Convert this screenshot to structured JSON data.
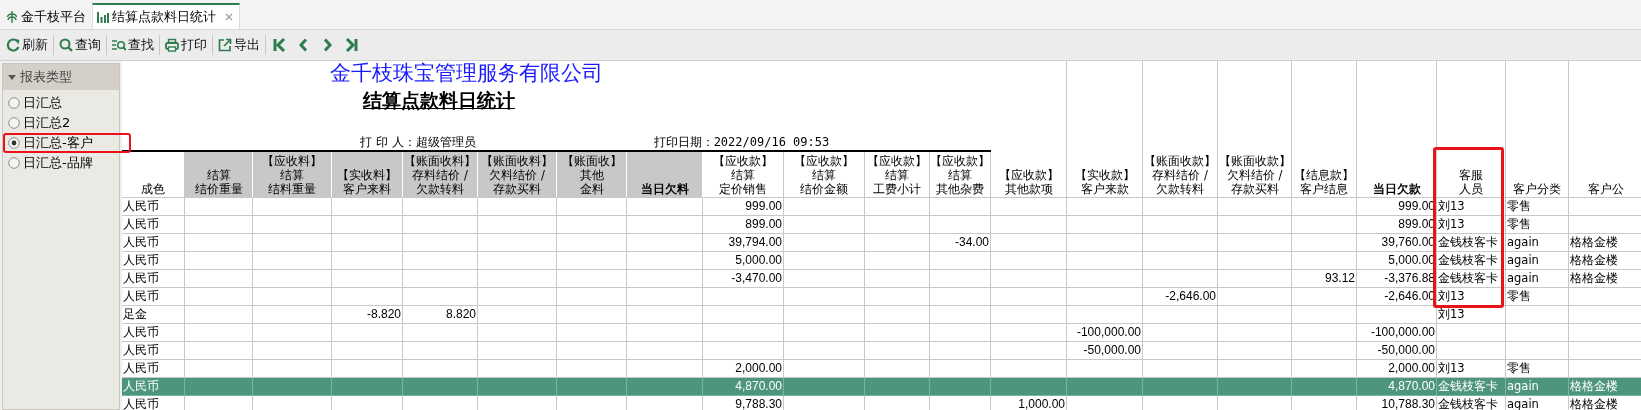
{
  "tabs": [
    {
      "label": "金千枝平台",
      "kind": "home",
      "selected": false,
      "closable": false
    },
    {
      "label": "结算点款料日统计",
      "kind": "report",
      "selected": true,
      "closable": true
    }
  ],
  "toolbar": {
    "buttons": [
      {
        "label": "刷新",
        "kind": "refresh"
      },
      {
        "label": "查询",
        "kind": "search"
      },
      {
        "label": "查找",
        "kind": "find"
      },
      {
        "label": "打印",
        "kind": "print"
      },
      {
        "label": "导出",
        "kind": "export"
      }
    ],
    "navigation": [
      {
        "kind": "first"
      },
      {
        "kind": "previous"
      },
      {
        "kind": "next"
      },
      {
        "kind": "last"
      }
    ]
  },
  "sidebar": {
    "title": "报表类型",
    "expanded": true,
    "items": [
      {
        "label": "日汇总",
        "selected": false,
        "highlighted": false
      },
      {
        "label": "日汇总2",
        "selected": false,
        "highlighted": false
      },
      {
        "label": "日汇总-客户",
        "selected": true,
        "highlighted": true
      },
      {
        "label": "日汇总-品牌",
        "selected": false,
        "highlighted": false
      }
    ]
  },
  "report": {
    "company": "金千枝珠宝管理服务有限公司",
    "title": "结算点款料日统计",
    "printed_by": "打 印 人：超级管理员",
    "print_date": "打印日期：2022/09/16 09:53",
    "columns": [
      {
        "lines": [
          "成色"
        ],
        "kind": "text",
        "shaded": false,
        "bold": false,
        "highlighted": false
      },
      {
        "lines": [
          "结算",
          "结价重量"
        ],
        "kind": "number",
        "shaded": true,
        "bold": false,
        "highlighted": false
      },
      {
        "lines": [
          "【应收料】",
          "结算",
          "结料重量"
        ],
        "kind": "number",
        "shaded": true,
        "bold": false,
        "highlighted": false
      },
      {
        "lines": [
          "【实收料】",
          "客户来料"
        ],
        "kind": "number",
        "shaded": true,
        "bold": false,
        "highlighted": false
      },
      {
        "lines": [
          "【账面收料】",
          "存料结价 /",
          "欠款转料"
        ],
        "kind": "number",
        "shaded": true,
        "bold": false,
        "highlighted": false
      },
      {
        "lines": [
          "【账面收料】",
          "欠料结价 /",
          "存款买料"
        ],
        "kind": "number",
        "shaded": true,
        "bold": false,
        "highlighted": false
      },
      {
        "lines": [
          "【账面收】",
          "其他",
          "金料"
        ],
        "kind": "number",
        "shaded": true,
        "bold": false,
        "highlighted": false
      },
      {
        "lines": [
          "当日欠料"
        ],
        "kind": "number",
        "shaded": true,
        "bold": true,
        "highlighted": false
      },
      {
        "lines": [
          "【应收款】",
          "结算",
          "定价销售"
        ],
        "kind": "number",
        "shaded": false,
        "bold": false,
        "highlighted": false
      },
      {
        "lines": [
          "【应收款】",
          "结算",
          "结价金额"
        ],
        "kind": "number",
        "shaded": false,
        "bold": false,
        "highlighted": false
      },
      {
        "lines": [
          "【应收款】",
          "结算",
          "工费小计"
        ],
        "kind": "number",
        "shaded": false,
        "bold": false,
        "highlighted": false
      },
      {
        "lines": [
          "【应收款】",
          "结算",
          "其他杂费"
        ],
        "kind": "number",
        "shaded": false,
        "bold": false,
        "highlighted": false
      },
      {
        "lines": [
          "【应收款】",
          "其他款项"
        ],
        "kind": "number",
        "shaded": false,
        "bold": false,
        "highlighted": false
      },
      {
        "lines": [
          "【实收款】",
          "客户来款"
        ],
        "kind": "number",
        "shaded": false,
        "bold": false,
        "highlighted": false
      },
      {
        "lines": [
          "【账面收款】",
          "存料结价 /",
          "欠款转料"
        ],
        "kind": "number",
        "shaded": false,
        "bold": false,
        "highlighted": false
      },
      {
        "lines": [
          "【账面收款】",
          "欠料结价 /",
          "存款买料"
        ],
        "kind": "number",
        "shaded": false,
        "bold": false,
        "highlighted": false
      },
      {
        "lines": [
          "【结息款】",
          "客户结息"
        ],
        "kind": "number",
        "shaded": false,
        "bold": false,
        "highlighted": false
      },
      {
        "lines": [
          "当日欠款"
        ],
        "kind": "number",
        "shaded": false,
        "bold": true,
        "highlighted": false
      },
      {
        "lines": [
          "客服",
          "人员"
        ],
        "kind": "text",
        "shaded": false,
        "bold": false,
        "highlighted": true
      },
      {
        "lines": [
          "客户分类"
        ],
        "kind": "text",
        "shaded": false,
        "bold": false,
        "highlighted": false
      },
      {
        "lines": [
          "客户公"
        ],
        "kind": "text",
        "shaded": false,
        "bold": false,
        "highlighted": false
      }
    ],
    "rows": [
      {
        "selected": false,
        "cells": [
          "人民币",
          null,
          null,
          null,
          null,
          null,
          null,
          null,
          "999.00",
          null,
          null,
          null,
          null,
          null,
          null,
          null,
          null,
          "999.00",
          "刘13",
          "零售",
          null
        ]
      },
      {
        "selected": false,
        "cells": [
          "人民币",
          null,
          null,
          null,
          null,
          null,
          null,
          null,
          "899.00",
          null,
          null,
          null,
          null,
          null,
          null,
          null,
          null,
          "899.00",
          "刘13",
          "零售",
          null
        ]
      },
      {
        "selected": false,
        "cells": [
          "人民币",
          null,
          null,
          null,
          null,
          null,
          null,
          null,
          "39,794.00",
          null,
          null,
          "-34.00",
          null,
          null,
          null,
          null,
          null,
          "39,760.00",
          "金钱枝客卡",
          "again",
          "格格金楼"
        ]
      },
      {
        "selected": false,
        "cells": [
          "人民币",
          null,
          null,
          null,
          null,
          null,
          null,
          null,
          "5,000.00",
          null,
          null,
          null,
          null,
          null,
          null,
          null,
          null,
          "5,000.00",
          "金钱枝客卡",
          "again",
          "格格金楼"
        ]
      },
      {
        "selected": false,
        "cells": [
          "人民币",
          null,
          null,
          null,
          null,
          null,
          null,
          null,
          "-3,470.00",
          null,
          null,
          null,
          null,
          null,
          null,
          null,
          "93.12",
          "-3,376.88",
          "金钱枝客卡",
          "again",
          "格格金楼"
        ]
      },
      {
        "selected": false,
        "cells": [
          "人民币",
          null,
          null,
          null,
          null,
          null,
          null,
          null,
          null,
          null,
          null,
          null,
          null,
          null,
          "-2,646.00",
          null,
          null,
          "-2,646.00",
          "刘13",
          "零售",
          null
        ]
      },
      {
        "selected": false,
        "cells": [
          "足金",
          null,
          null,
          "-8.820",
          "8.820",
          null,
          null,
          null,
          null,
          null,
          null,
          null,
          null,
          null,
          null,
          null,
          null,
          null,
          "刘13",
          null,
          null
        ]
      },
      {
        "selected": false,
        "cells": [
          "人民币",
          null,
          null,
          null,
          null,
          null,
          null,
          null,
          null,
          null,
          null,
          null,
          null,
          "-100,000.00",
          null,
          null,
          null,
          "-100,000.00",
          null,
          null,
          null
        ]
      },
      {
        "selected": false,
        "cells": [
          "人民币",
          null,
          null,
          null,
          null,
          null,
          null,
          null,
          null,
          null,
          null,
          null,
          null,
          "-50,000.00",
          null,
          null,
          null,
          "-50,000.00",
          null,
          null,
          null
        ]
      },
      {
        "selected": false,
        "cells": [
          "人民币",
          null,
          null,
          null,
          null,
          null,
          null,
          null,
          "2,000.00",
          null,
          null,
          null,
          null,
          null,
          null,
          null,
          null,
          "2,000.00",
          "刘13",
          "零售",
          null
        ]
      },
      {
        "selected": true,
        "cells": [
          "人民币",
          null,
          null,
          null,
          null,
          null,
          null,
          null,
          "4,870.00",
          null,
          null,
          null,
          null,
          null,
          null,
          null,
          null,
          "4,870.00",
          "金钱枝客卡",
          "again",
          "格格金楼"
        ]
      },
      {
        "selected": false,
        "cells": [
          "人民币",
          null,
          null,
          null,
          null,
          null,
          null,
          null,
          "9,788.30",
          null,
          null,
          null,
          "1,000.00",
          null,
          null,
          null,
          null,
          "10,788.30",
          "金钱枝客卡",
          "again",
          "格格金楼"
        ]
      }
    ]
  }
}
